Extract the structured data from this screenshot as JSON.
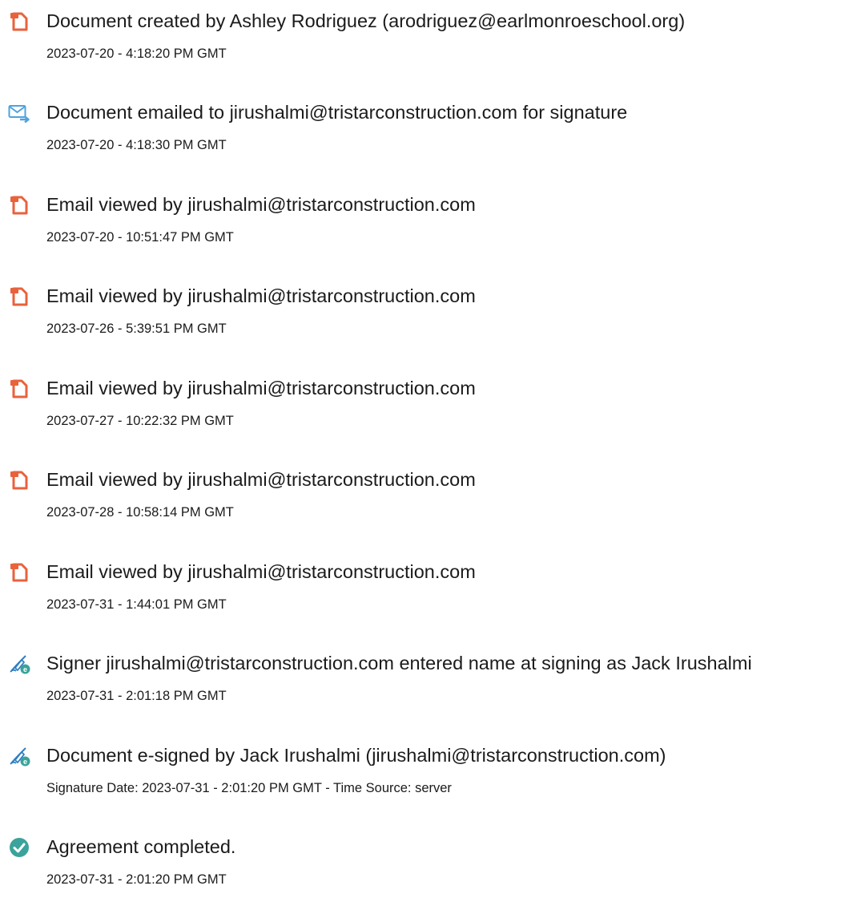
{
  "colors": {
    "document_icon": "#e8623c",
    "email_icon": "#4fa3dd",
    "sign_icon": "#2e7fc1",
    "sign_badge": "#3aa39b",
    "complete_icon": "#3aa39b"
  },
  "events": [
    {
      "icon": "document-icon",
      "title": "Document created by Ashley Rodriguez (arodriguez@earlmonroeschool.org)",
      "timestamp": "2023-07-20 - 4:18:20 PM GMT"
    },
    {
      "icon": "email-sent-icon",
      "title": "Document emailed to jirushalmi@tristarconstruction.com for signature",
      "timestamp": "2023-07-20 - 4:18:30 PM GMT"
    },
    {
      "icon": "document-icon",
      "title": "Email viewed by jirushalmi@tristarconstruction.com",
      "timestamp": "2023-07-20 - 10:51:47 PM GMT"
    },
    {
      "icon": "document-icon",
      "title": "Email viewed by jirushalmi@tristarconstruction.com",
      "timestamp": "2023-07-26 - 5:39:51 PM GMT"
    },
    {
      "icon": "document-icon",
      "title": "Email viewed by jirushalmi@tristarconstruction.com",
      "timestamp": "2023-07-27 - 10:22:32 PM GMT"
    },
    {
      "icon": "document-icon",
      "title": "Email viewed by jirushalmi@tristarconstruction.com",
      "timestamp": "2023-07-28 - 10:58:14 PM GMT"
    },
    {
      "icon": "document-icon",
      "title": "Email viewed by jirushalmi@tristarconstruction.com",
      "timestamp": "2023-07-31 - 1:44:01 PM GMT"
    },
    {
      "icon": "pen-sign-icon",
      "title": "Signer jirushalmi@tristarconstruction.com entered name at signing as Jack Irushalmi",
      "timestamp": "2023-07-31 - 2:01:18 PM GMT"
    },
    {
      "icon": "pen-sign-icon",
      "title": "Document e-signed by Jack Irushalmi (jirushalmi@tristarconstruction.com)",
      "timestamp": "Signature Date: 2023-07-31 - 2:01:20 PM GMT - Time Source: server"
    },
    {
      "icon": "check-circle-icon",
      "title": "Agreement completed.",
      "timestamp": "2023-07-31 - 2:01:20 PM GMT"
    }
  ]
}
